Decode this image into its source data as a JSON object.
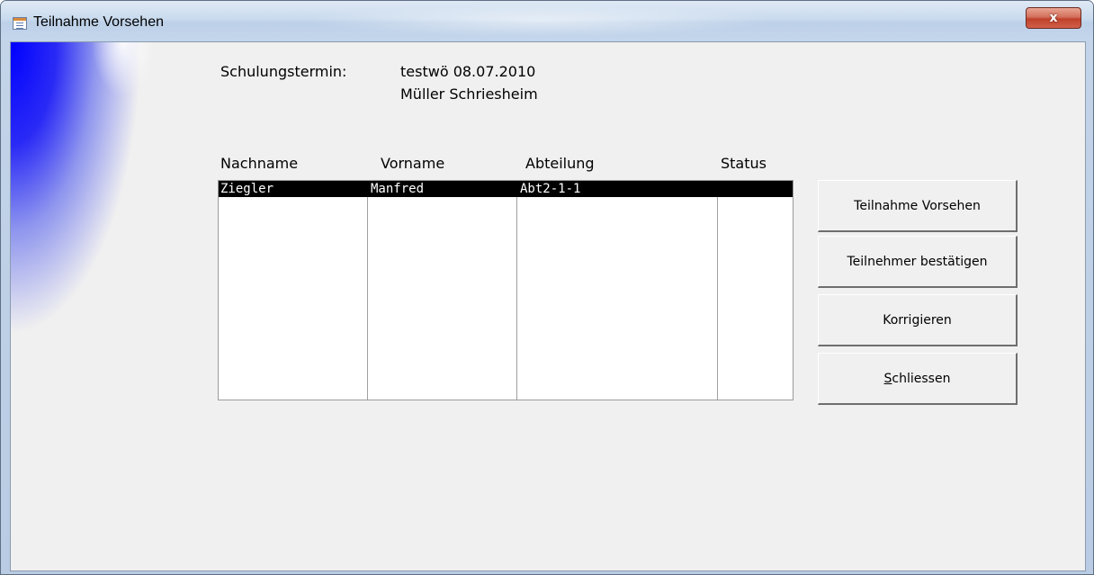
{
  "window": {
    "title": "Teilnahme Vorsehen",
    "close_label": "x"
  },
  "info": {
    "label": "Schulungstermin:",
    "value_line1": "testwö 08.07.2010",
    "value_line2": "Müller Schriesheim"
  },
  "table": {
    "columns": [
      "Nachname",
      "Vorname",
      "Abteilung",
      "Status"
    ],
    "rows": [
      {
        "nachname": "Ziegler",
        "vorname": "Manfred",
        "abteilung": "Abt2-1-1",
        "status": ""
      }
    ]
  },
  "buttons": {
    "teilnahme_vorsehen": "Teilnahme Vorsehen",
    "teilnehmer_bestaetigen": "Teilnehmer bestätigen",
    "korrigieren": "Korrigieren",
    "schliessen_accel": "S",
    "schliessen_rest": "chliessen"
  },
  "colors": {
    "selection_bg": "#000000",
    "selection_fg": "#ffffff",
    "form_bg": "#f0f0f0",
    "decoration_blue": "#0000ff"
  }
}
